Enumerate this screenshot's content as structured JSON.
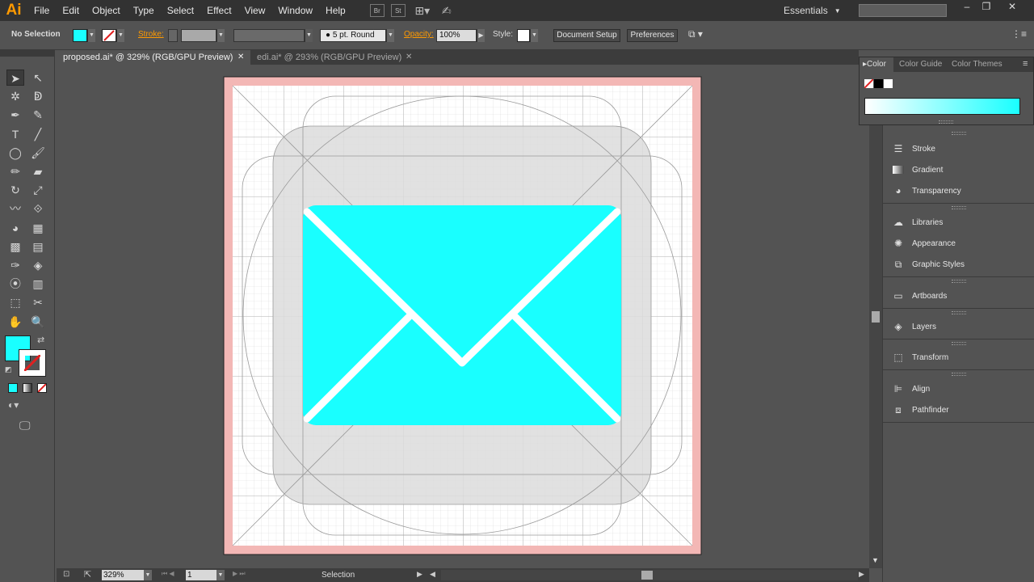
{
  "app": {
    "logo": "Ai"
  },
  "menu": [
    "File",
    "Edit",
    "Object",
    "Type",
    "Select",
    "Effect",
    "View",
    "Window",
    "Help"
  ],
  "menu_icons": [
    "bridge-icon",
    "stock-icon",
    "arrange-documents-icon",
    "brush-gpu-icon"
  ],
  "workspace": {
    "label": "Essentials"
  },
  "search": {
    "placeholder": ""
  },
  "window_controls": [
    "–",
    "❐",
    "✕"
  ],
  "control": {
    "selection_status": "No Selection",
    "fill_color": "#19ffff",
    "stroke_label": "Stroke:",
    "brush_label": "5 pt. Round",
    "opacity_label": "Opacity:",
    "opacity_value": "100%",
    "style_label": "Style:",
    "document_setup": "Document Setup",
    "preferences": "Preferences"
  },
  "tabs": [
    {
      "title": "proposed.ai* @ 329% (RGB/GPU Preview)",
      "close": "✕"
    },
    {
      "title": "edi.ai* @ 293% (RGB/GPU Preview)",
      "close": "✕"
    }
  ],
  "tools": [
    "selection-tool",
    "direct-selection-tool",
    "magic-wand-tool",
    "lasso-tool",
    "pen-tool",
    "curvature-tool",
    "type-tool",
    "line-tool",
    "ellipse-tool",
    "paintbrush-tool",
    "pencil-tool",
    "eraser-tool",
    "rotate-tool",
    "scale-tool",
    "warp-tool",
    "free-transform-tool",
    "shape-builder-tool",
    "perspective-grid-tool",
    "mesh-tool",
    "gradient-tool",
    "eyedropper-tool",
    "blend-tool",
    "symbol-sprayer-tool",
    "column-graph-tool",
    "artboard-tool",
    "slice-tool",
    "hand-tool",
    "zoom-tool"
  ],
  "tool_glyphs": [
    "➤",
    "↖",
    "✲",
    "ↁ",
    "✒",
    "✎",
    "T",
    "╱",
    "◯",
    "🖌",
    "✏",
    "▰",
    "↻",
    "⤢",
    "〰",
    "⟐",
    "◕",
    "▦",
    "▩",
    "▤",
    "✑",
    "◈",
    "⦿",
    "▥",
    "⬚",
    "✂",
    "✋",
    "🔍"
  ],
  "colors": {
    "fill": "#19ffff",
    "stroke": "#ffffff",
    "accent": "#ff9a00",
    "artboard_bleed": "#f3b7b5"
  },
  "color_panel": {
    "tabs": [
      "Color",
      "Color Guide",
      "Color Themes"
    ],
    "spectrum_color": "#19ffff"
  },
  "panels": [
    "Stroke",
    "Gradient",
    "Transparency",
    "Libraries",
    "Appearance",
    "Graphic Styles",
    "Artboards",
    "Layers",
    "Transform",
    "Align",
    "Pathfinder"
  ],
  "panel_icons": [
    "stroke-icon",
    "gradient-icon",
    "transparency-icon",
    "libraries-icon",
    "appearance-icon",
    "graphic-styles-icon",
    "artboards-icon",
    "layers-icon",
    "transform-icon",
    "align-icon",
    "pathfinder-icon"
  ],
  "status": {
    "zoom": "329%",
    "artboard": "1",
    "tool": "Selection"
  }
}
